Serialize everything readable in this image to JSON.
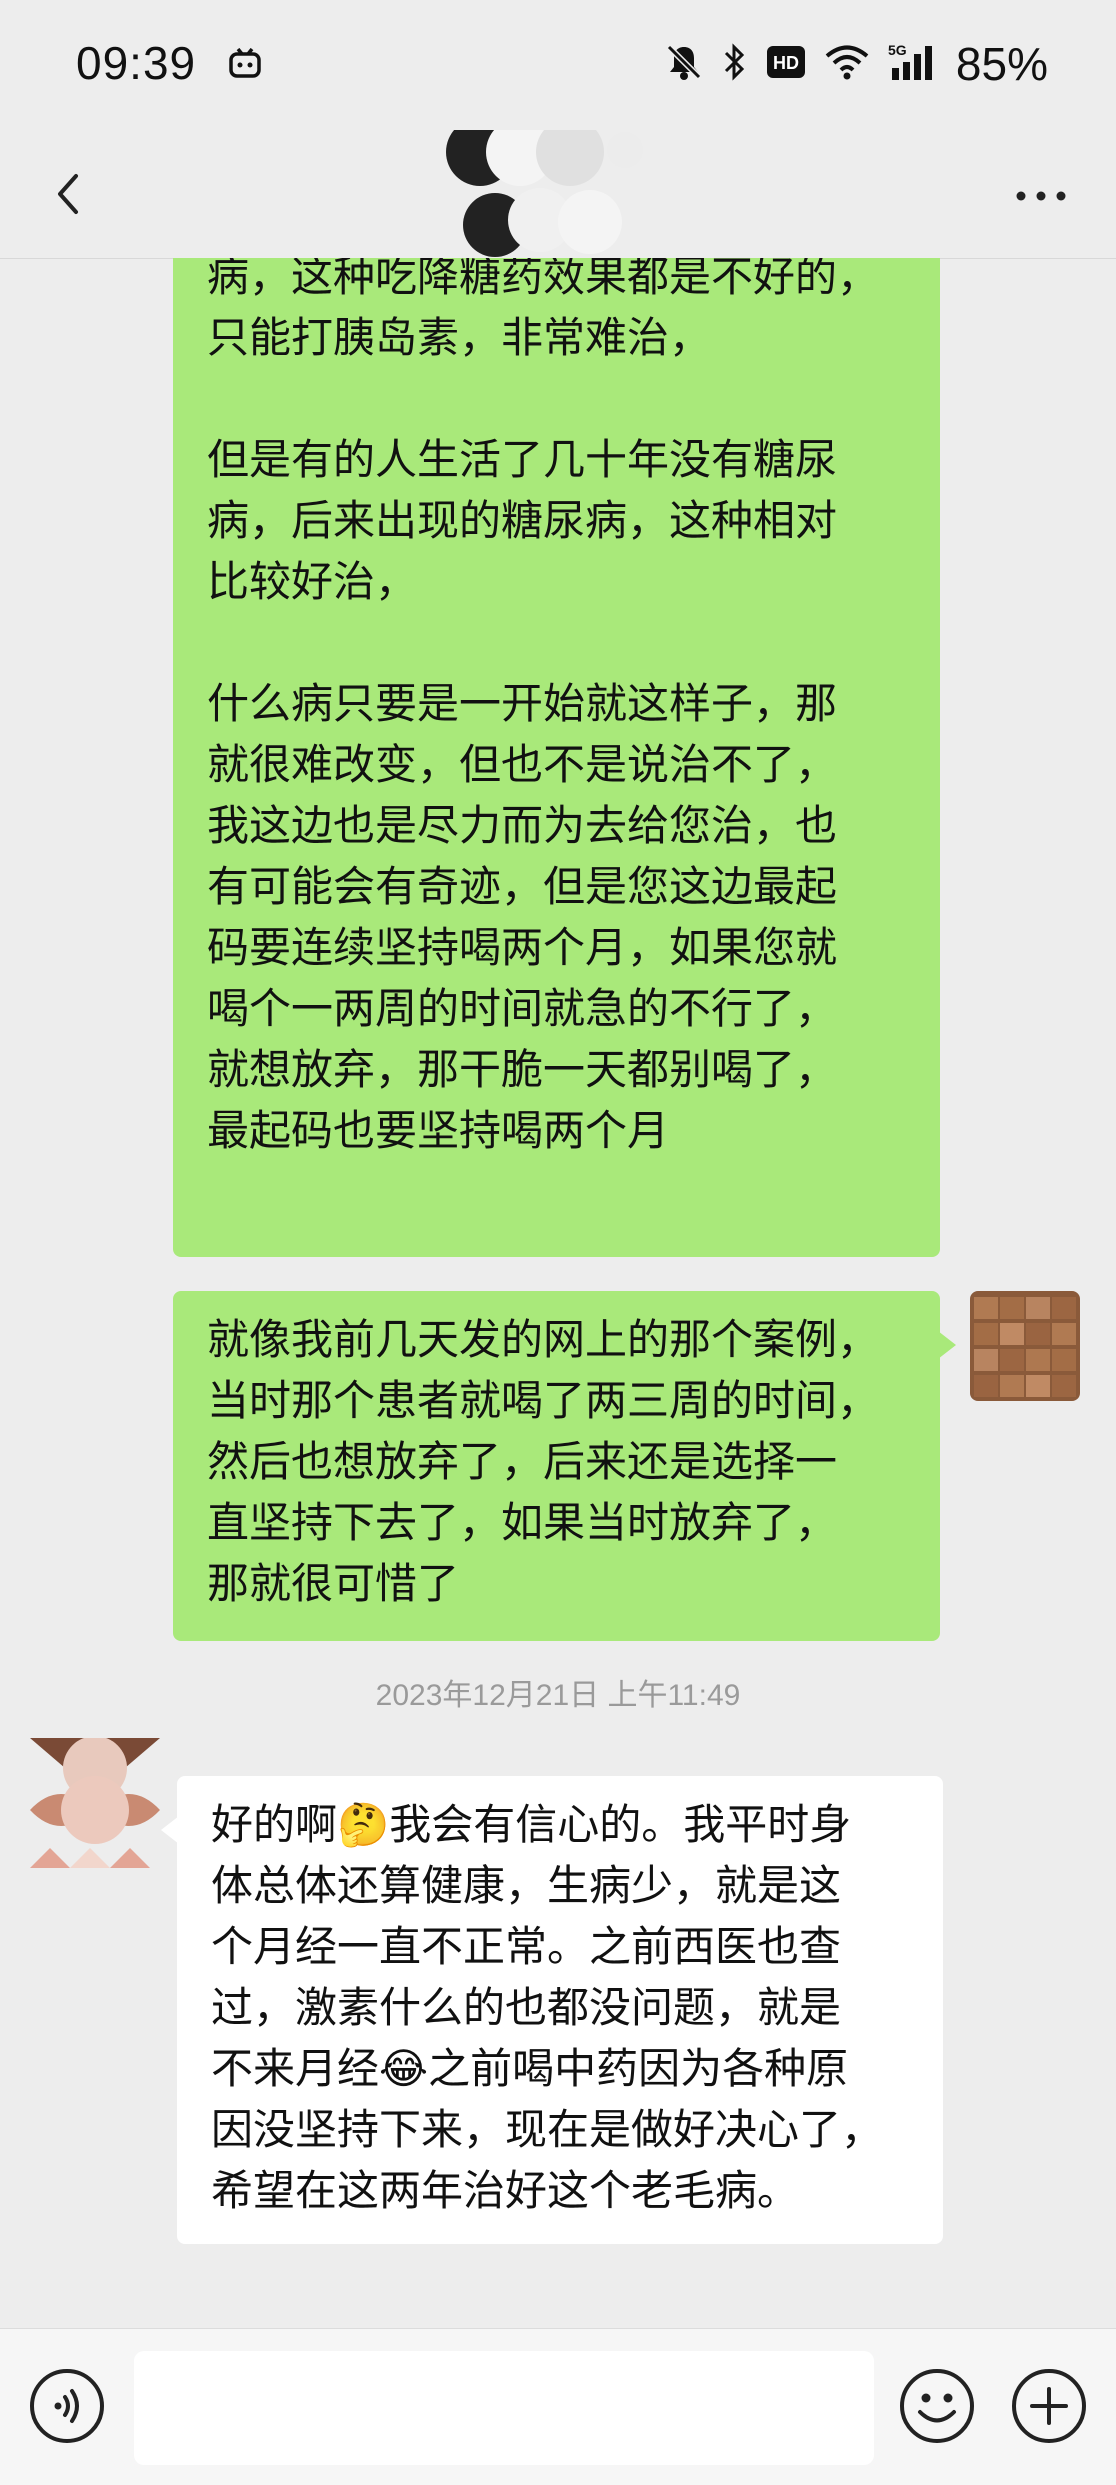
{
  "status_bar": {
    "time": "09:39",
    "battery": "85%",
    "icons": [
      "app-notification-icon",
      "mute-icon",
      "bluetooth-icon",
      "hd-icon",
      "wifi-icon",
      "5g-signal-icon"
    ],
    "hd_text": "HD",
    "network_text": "5G"
  },
  "header": {
    "back_icon": "chevron-left-icon",
    "more_icon": "more-dots-icon"
  },
  "messages": [
    {
      "direction": "out",
      "text": "病，这种吃降糖药效果都是不好的，\n只能打胰岛素，非常难治，\n\n但是有的人生活了几十年没有糖尿\n病，后来出现的糖尿病，这种相对\n比较好治，\n\n什么病只要是一开始就这样子，那\n就很难改变，但也不是说治不了，\n我这边也是尽力而为去给您治，也\n有可能会有奇迹，但是您这边最起\n码要连续坚持喝两个月，如果您就\n喝个一两周的时间就急的不行了，\n就想放弃，那干脆一天都别喝了，\n最起码也要坚持喝两个月"
    },
    {
      "direction": "out",
      "text": "就像我前几天发的网上的那个案例，\n当时那个患者就喝了两三周的时间，\n然后也想放弃了，后来还是选择一\n直坚持下去了，如果当时放弃了，\n那就很可惜了"
    },
    {
      "direction": "in",
      "text": "好的啊🤔我会有信心的。我平时身\n体总体还算健康，生病少，就是这\n个月经一直不正常。之前西医也查\n过，激素什么的也都没问题，就是\n不来月经😂之前喝中药因为各种原\n因没坚持下来，现在是做好决心了，\n希望在这两年治好这个老毛病。"
    }
  ],
  "timestamp": "2023年12月21日 上午11:49",
  "input_bar": {
    "voice_icon": "voice-icon",
    "emoji_icon": "emoji-icon",
    "plus_icon": "plus-icon",
    "input_value": ""
  },
  "colors": {
    "background": "#ededed",
    "outgoing_bubble": "#a9e97a",
    "incoming_bubble": "#ffffff",
    "timestamp": "#9a9a9a"
  }
}
